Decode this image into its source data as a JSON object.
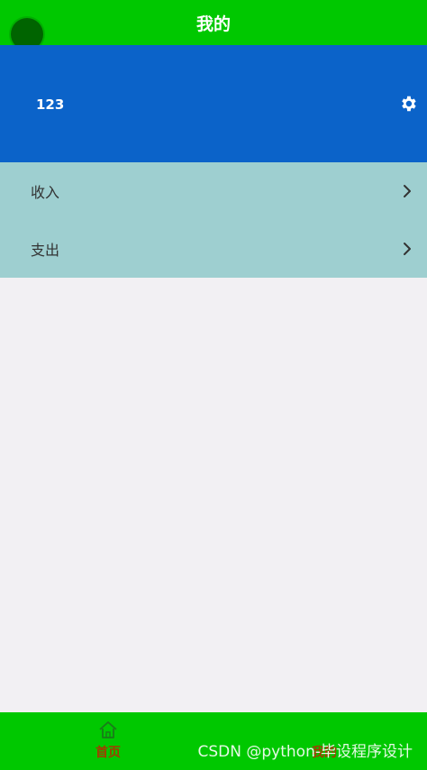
{
  "header": {
    "title": "我的"
  },
  "profile": {
    "username": "123",
    "settings_icon": "gear-icon"
  },
  "menu": {
    "items": [
      {
        "label": "收入",
        "icon": "chevron-right-icon"
      },
      {
        "label": "支出",
        "icon": "chevron-right-icon"
      }
    ]
  },
  "tabbar": {
    "items": [
      {
        "label": "首页",
        "icon": "home-icon"
      },
      {
        "label": "我的",
        "icon": ""
      }
    ]
  },
  "watermark": {
    "text": "CSDN @python-毕设程序设计"
  },
  "colors": {
    "header_bg": "#00c800",
    "profile_bg": "#0b63c9",
    "menu_bg": "#9ecfd0",
    "page_bg": "#f2f0f3",
    "tab_label": "#a33b00"
  }
}
